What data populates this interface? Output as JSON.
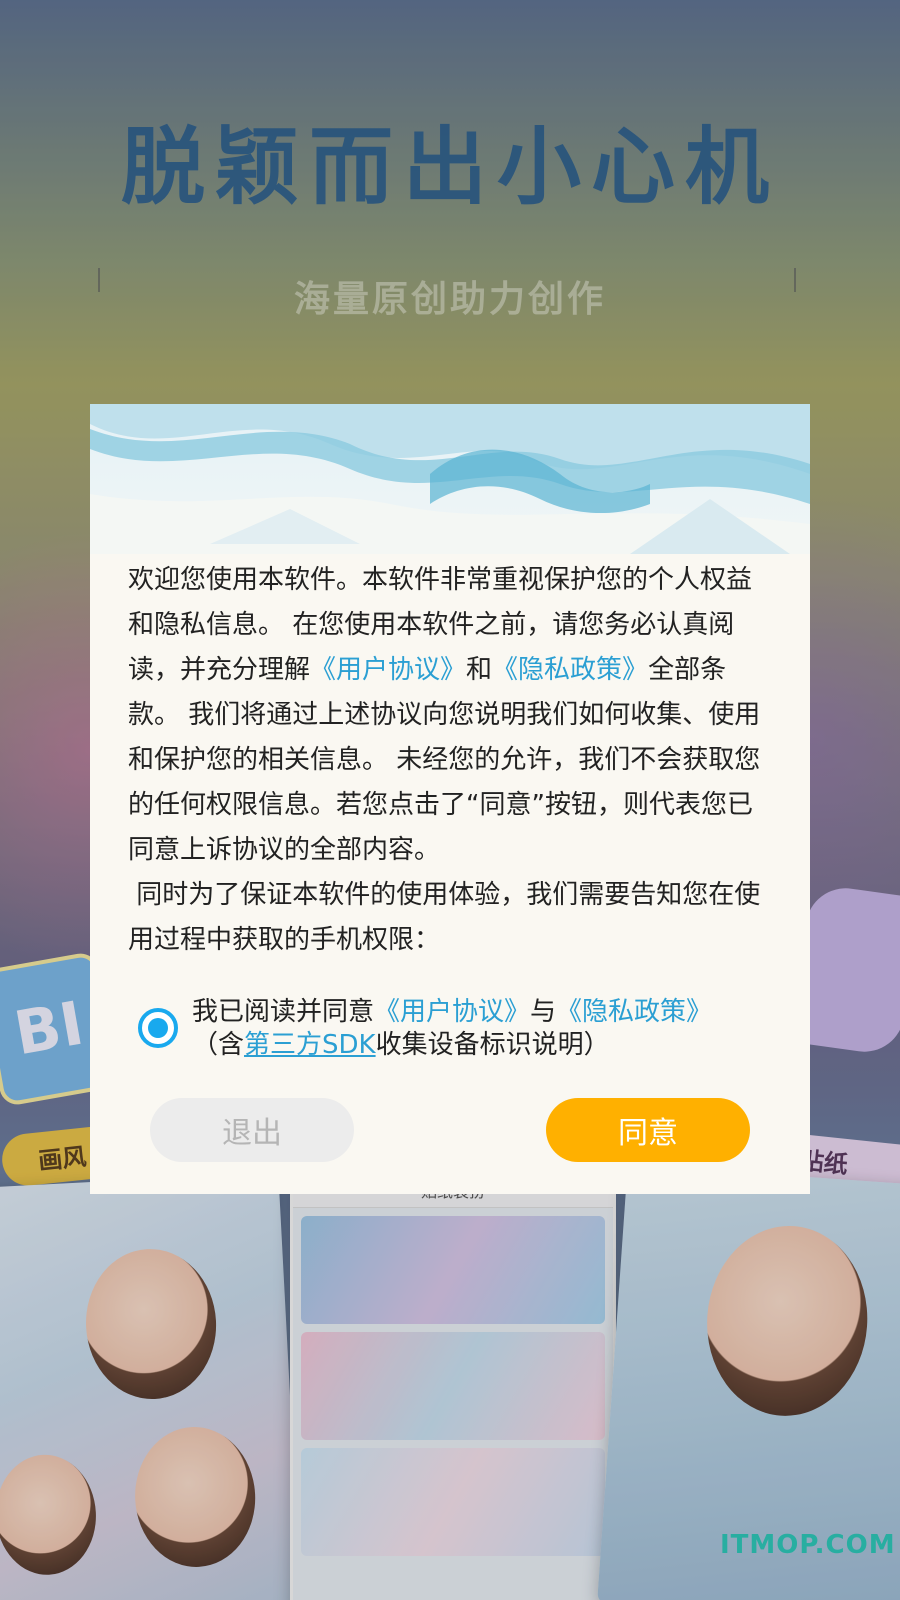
{
  "background": {
    "title": "脱颖而出小心机",
    "subtitle": "海量原创助力创作",
    "badge_left": "画风",
    "badge_right": "贴纸",
    "sticker_left": "BI",
    "phone_header": "贴纸装扮",
    "watermark": "ITMOP.COM"
  },
  "dialog": {
    "intro_parts": [
      "欢迎您使用本软件。本软件非常重视保护您的个人权益和隐私信息。 在您使用本软件之前，请您务必认真阅读，并充分理解",
      "《用户协议》",
      "和",
      "《隐私政策》",
      "全部条款。 我们将通过上述协议向您说明我们如何收集、使用和保护您的相关信息。 未经您的允许，我们不会获取您的任何权限信息。若您点击了“同意”按钮，则代表您已同意上诉协议的全部内容。"
    ],
    "permissions_text": " 同时为了保证本软件的使用体验，我们需要告知您在使用过程中获取的手机权限：",
    "consent": {
      "checked": true,
      "prefix": "我已阅读并同意",
      "user_agreement": "《用户协议》",
      "and": "与",
      "privacy_policy": "《隐私政策》",
      "paren_open": "（含",
      "sdk_link": "第三方SDK",
      "sdk_suffix": "收集设备标识说明）"
    },
    "exit_label": "退出",
    "agree_label": "同意"
  },
  "colors": {
    "link": "#2b9fd3",
    "agree_button": "#ffb000",
    "exit_button": "#ececec",
    "radio": "#19a9ee",
    "dialog_bg": "#faf8f2"
  }
}
